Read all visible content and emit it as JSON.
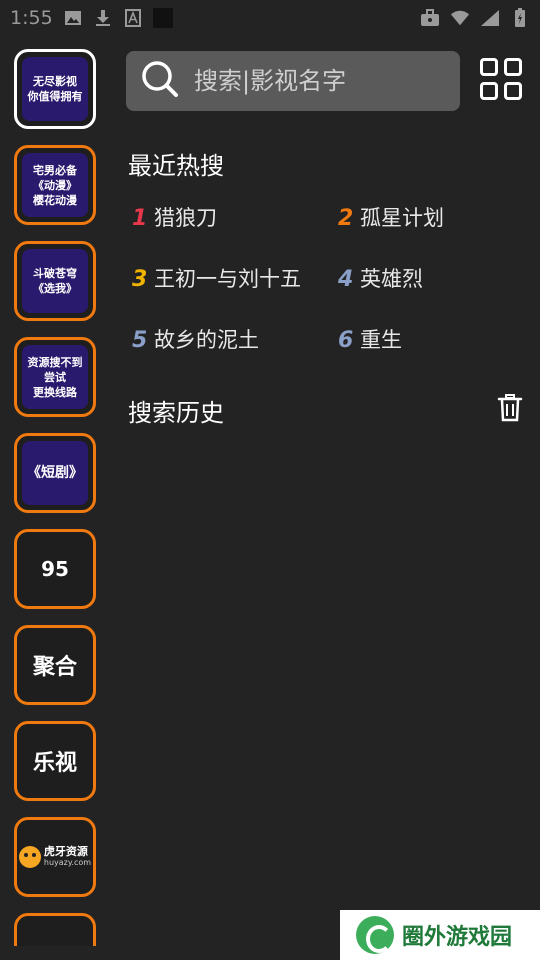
{
  "status": {
    "time": "1:55",
    "left_icons": [
      "image-icon",
      "download-icon",
      "a-icon",
      "square-icon"
    ],
    "right_icons": [
      "briefcase-icon",
      "wifi-icon",
      "signal-icon",
      "battery-icon"
    ]
  },
  "sources": [
    {
      "kind": "tile",
      "lines": [
        "无尽影视",
        "你值得拥有"
      ],
      "active": true
    },
    {
      "kind": "tile",
      "lines": [
        "宅男必备",
        "《动漫》",
        "樱花动漫"
      ]
    },
    {
      "kind": "tile",
      "lines": [
        "斗破苍穹",
        "《选我》"
      ]
    },
    {
      "kind": "tile",
      "lines": [
        "资源搜不到",
        "尝试",
        "更换线路"
      ]
    },
    {
      "kind": "tile",
      "lines": [
        "《短剧》"
      ]
    },
    {
      "kind": "text",
      "label": "95"
    },
    {
      "kind": "text",
      "label": "聚合"
    },
    {
      "kind": "text",
      "label": "乐视"
    },
    {
      "kind": "logo",
      "title": "虎牙资源",
      "sub": "huyazy.com"
    }
  ],
  "search": {
    "placeholder": "搜索|影视名字"
  },
  "hot": {
    "title": "最近热搜",
    "items": [
      {
        "rank": "1",
        "name": "猎狼刀",
        "color": "#e8374a"
      },
      {
        "rank": "2",
        "name": "孤星计划",
        "color": "#f07a10"
      },
      {
        "rank": "3",
        "name": "王初一与刘十五",
        "color": "#f0b400"
      },
      {
        "rank": "4",
        "name": "英雄烈",
        "color": "#8aa0c8"
      },
      {
        "rank": "5",
        "name": "故乡的泥土",
        "color": "#8aa0c8"
      },
      {
        "rank": "6",
        "name": "重生",
        "color": "#8aa0c8"
      }
    ]
  },
  "history": {
    "title": "搜索历史"
  },
  "watermark": {
    "text": "圈外游戏园"
  }
}
